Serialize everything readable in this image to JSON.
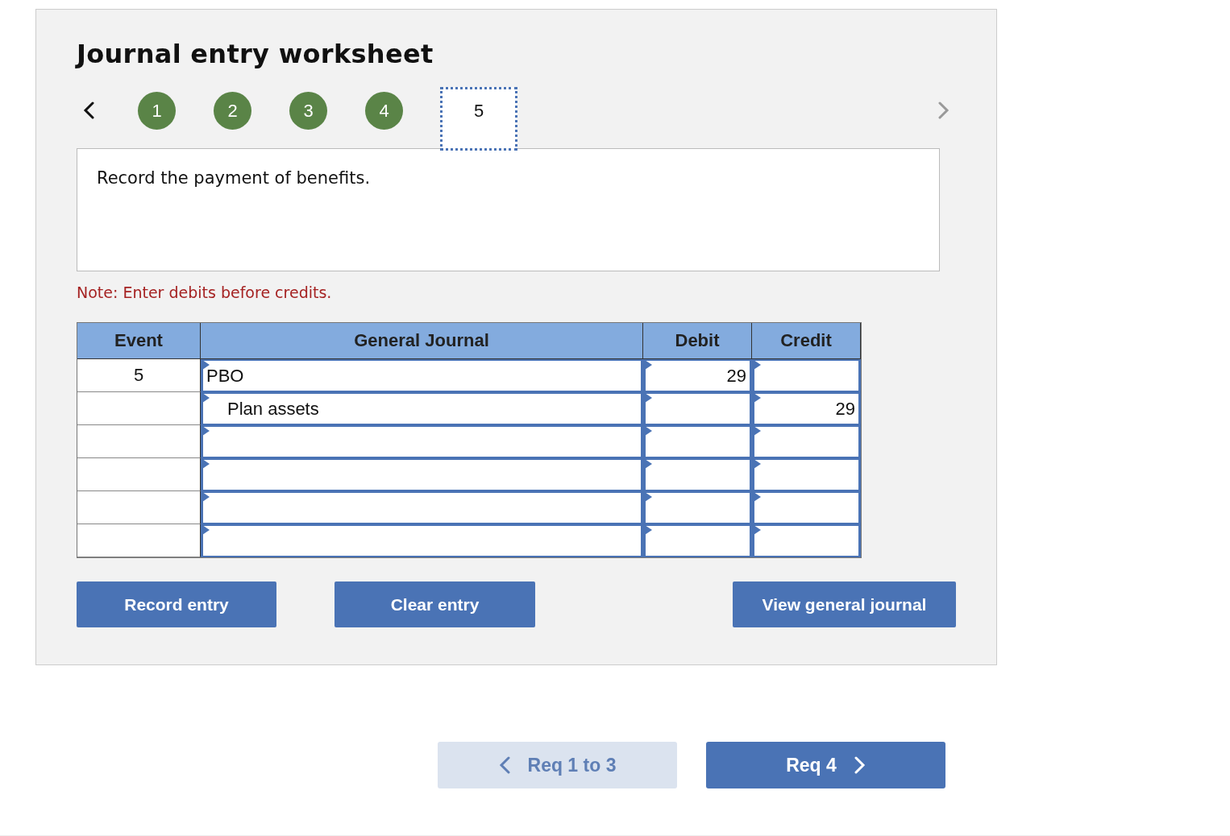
{
  "title": "Journal entry worksheet",
  "steps": [
    {
      "label": "1",
      "completed": true,
      "selected": false
    },
    {
      "label": "2",
      "completed": true,
      "selected": false
    },
    {
      "label": "3",
      "completed": true,
      "selected": false
    },
    {
      "label": "4",
      "completed": true,
      "selected": false
    },
    {
      "label": "5",
      "completed": false,
      "selected": true
    }
  ],
  "prev_disabled": false,
  "next_disabled": true,
  "question": "Record the payment of benefits.",
  "note": "Note: Enter debits before credits.",
  "table": {
    "columns": [
      "Event",
      "General Journal",
      "Debit",
      "Credit"
    ],
    "rows": [
      {
        "event": "5",
        "account": "PBO",
        "indented": false,
        "debit": "29"
      },
      {
        "account": "Plan assets",
        "indented": true,
        "credit": "29"
      },
      {},
      {},
      {},
      {}
    ]
  },
  "buttons": [
    "Record entry",
    "Clear entry",
    "View general journal"
  ],
  "nav": [
    {
      "label": "Req 1 to 3",
      "kind": "prev",
      "disabled": true
    },
    {
      "label": "Req 4",
      "kind": "next",
      "disabled": false
    }
  ]
}
